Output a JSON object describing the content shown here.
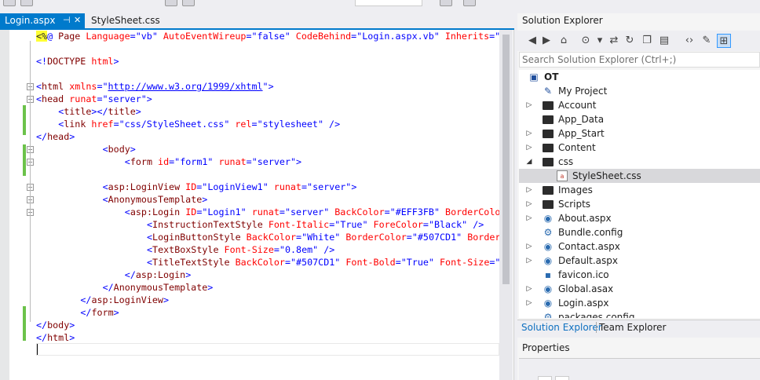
{
  "document_tabs": [
    {
      "label": "Login.aspx",
      "pin": "⊣",
      "close": "✕"
    },
    {
      "label": "StyleSheet.css"
    }
  ],
  "editor": {
    "lines": [
      {
        "indent": 0,
        "tokens": [
          {
            "t": "<%",
            "c": "c-asp"
          },
          {
            "t": "@",
            "c": "c-delim"
          },
          {
            "t": " Page ",
            "c": "c-tag"
          },
          {
            "t": "Language",
            "c": "c-attr"
          },
          {
            "t": "=",
            "c": "c-delim"
          },
          {
            "t": "\"vb\"",
            "c": "c-str"
          },
          {
            "t": " AutoEventWireup",
            "c": "c-attr"
          },
          {
            "t": "=",
            "c": "c-delim"
          },
          {
            "t": "\"false\"",
            "c": "c-str"
          },
          {
            "t": " CodeBehind",
            "c": "c-attr"
          },
          {
            "t": "=",
            "c": "c-delim"
          },
          {
            "t": "\"Login.aspx.vb\"",
            "c": "c-str"
          },
          {
            "t": " Inherits",
            "c": "c-attr"
          },
          {
            "t": "=",
            "c": "c-delim"
          },
          {
            "t": "\"O",
            "c": "c-str"
          }
        ]
      },
      {
        "indent": 0,
        "tokens": []
      },
      {
        "indent": 0,
        "tokens": [
          {
            "t": "<!",
            "c": "c-delim"
          },
          {
            "t": "DOCTYPE",
            "c": "c-tag"
          },
          {
            "t": " html",
            "c": "c-attr"
          },
          {
            "t": ">",
            "c": "c-delim"
          }
        ]
      },
      {
        "indent": 0,
        "tokens": []
      },
      {
        "indent": 0,
        "tokens": [
          {
            "t": "<",
            "c": "c-delim"
          },
          {
            "t": "html",
            "c": "c-tag"
          },
          {
            "t": " xmlns",
            "c": "c-attr"
          },
          {
            "t": "=\"",
            "c": "c-delim"
          },
          {
            "t": "http://www.w3.org/1999/xhtml",
            "c": "c-link"
          },
          {
            "t": "\">",
            "c": "c-delim"
          }
        ]
      },
      {
        "indent": 0,
        "tokens": [
          {
            "t": "<",
            "c": "c-delim"
          },
          {
            "t": "head",
            "c": "c-tag"
          },
          {
            "t": " runat",
            "c": "c-attr"
          },
          {
            "t": "=",
            "c": "c-delim"
          },
          {
            "t": "\"server\"",
            "c": "c-str"
          },
          {
            "t": ">",
            "c": "c-delim"
          }
        ]
      },
      {
        "indent": 4,
        "tokens": [
          {
            "t": "<",
            "c": "c-delim"
          },
          {
            "t": "title",
            "c": "c-tag"
          },
          {
            "t": "></",
            "c": "c-delim"
          },
          {
            "t": "title",
            "c": "c-tag"
          },
          {
            "t": ">",
            "c": "c-delim"
          }
        ]
      },
      {
        "indent": 4,
        "tokens": [
          {
            "t": "<",
            "c": "c-delim"
          },
          {
            "t": "link",
            "c": "c-tag"
          },
          {
            "t": " href",
            "c": "c-attr"
          },
          {
            "t": "=",
            "c": "c-delim"
          },
          {
            "t": "\"css/StyleSheet.css\"",
            "c": "c-str"
          },
          {
            "t": " rel",
            "c": "c-attr"
          },
          {
            "t": "=",
            "c": "c-delim"
          },
          {
            "t": "\"stylesheet\"",
            "c": "c-str"
          },
          {
            "t": " />",
            "c": "c-delim"
          }
        ]
      },
      {
        "indent": 0,
        "tokens": [
          {
            "t": "</",
            "c": "c-delim"
          },
          {
            "t": "head",
            "c": "c-tag"
          },
          {
            "t": ">",
            "c": "c-delim"
          }
        ]
      },
      {
        "indent": 12,
        "tokens": [
          {
            "t": "<",
            "c": "c-delim"
          },
          {
            "t": "body",
            "c": "c-tag"
          },
          {
            "t": ">",
            "c": "c-delim"
          }
        ]
      },
      {
        "indent": 16,
        "tokens": [
          {
            "t": "<",
            "c": "c-delim"
          },
          {
            "t": "form",
            "c": "c-tag"
          },
          {
            "t": " id",
            "c": "c-attr"
          },
          {
            "t": "=",
            "c": "c-delim"
          },
          {
            "t": "\"form1\"",
            "c": "c-str"
          },
          {
            "t": " runat",
            "c": "c-attr"
          },
          {
            "t": "=",
            "c": "c-delim"
          },
          {
            "t": "\"server\"",
            "c": "c-str"
          },
          {
            "t": ">",
            "c": "c-delim"
          }
        ]
      },
      {
        "indent": 0,
        "tokens": []
      },
      {
        "indent": 12,
        "tokens": [
          {
            "t": "<",
            "c": "c-delim"
          },
          {
            "t": "asp:LoginView",
            "c": "c-tag"
          },
          {
            "t": " ID",
            "c": "c-attr"
          },
          {
            "t": "=",
            "c": "c-delim"
          },
          {
            "t": "\"LoginView1\"",
            "c": "c-str"
          },
          {
            "t": " runat",
            "c": "c-attr"
          },
          {
            "t": "=",
            "c": "c-delim"
          },
          {
            "t": "\"server\"",
            "c": "c-str"
          },
          {
            "t": ">",
            "c": "c-delim"
          }
        ]
      },
      {
        "indent": 12,
        "tokens": [
          {
            "t": "<",
            "c": "c-delim"
          },
          {
            "t": "AnonymousTemplate",
            "c": "c-tag"
          },
          {
            "t": ">",
            "c": "c-delim"
          }
        ]
      },
      {
        "indent": 16,
        "tokens": [
          {
            "t": "<",
            "c": "c-delim"
          },
          {
            "t": "asp:Login",
            "c": "c-tag"
          },
          {
            "t": " ID",
            "c": "c-attr"
          },
          {
            "t": "=",
            "c": "c-delim"
          },
          {
            "t": "\"Login1\"",
            "c": "c-str"
          },
          {
            "t": " runat",
            "c": "c-attr"
          },
          {
            "t": "=",
            "c": "c-delim"
          },
          {
            "t": "\"server\"",
            "c": "c-str"
          },
          {
            "t": " BackColor",
            "c": "c-attr"
          },
          {
            "t": "=",
            "c": "c-delim"
          },
          {
            "t": "\"#EFF3FB\"",
            "c": "c-str"
          },
          {
            "t": " BorderColo",
            "c": "c-attr"
          }
        ]
      },
      {
        "indent": 20,
        "tokens": [
          {
            "t": "<",
            "c": "c-delim"
          },
          {
            "t": "InstructionTextStyle",
            "c": "c-tag"
          },
          {
            "t": " Font-Italic",
            "c": "c-attr"
          },
          {
            "t": "=",
            "c": "c-delim"
          },
          {
            "t": "\"True\"",
            "c": "c-str"
          },
          {
            "t": " ForeColor",
            "c": "c-attr"
          },
          {
            "t": "=",
            "c": "c-delim"
          },
          {
            "t": "\"Black\"",
            "c": "c-str"
          },
          {
            "t": " />",
            "c": "c-delim"
          }
        ]
      },
      {
        "indent": 20,
        "tokens": [
          {
            "t": "<",
            "c": "c-delim"
          },
          {
            "t": "LoginButtonStyle",
            "c": "c-tag"
          },
          {
            "t": " BackColor",
            "c": "c-attr"
          },
          {
            "t": "=",
            "c": "c-delim"
          },
          {
            "t": "\"White\"",
            "c": "c-str"
          },
          {
            "t": " BorderColor",
            "c": "c-attr"
          },
          {
            "t": "=",
            "c": "c-delim"
          },
          {
            "t": "\"#507CD1\"",
            "c": "c-str"
          },
          {
            "t": " BorderS",
            "c": "c-attr"
          }
        ]
      },
      {
        "indent": 20,
        "tokens": [
          {
            "t": "<",
            "c": "c-delim"
          },
          {
            "t": "TextBoxStyle",
            "c": "c-tag"
          },
          {
            "t": " Font-Size",
            "c": "c-attr"
          },
          {
            "t": "=",
            "c": "c-delim"
          },
          {
            "t": "\"0.8em\"",
            "c": "c-str"
          },
          {
            "t": " />",
            "c": "c-delim"
          }
        ]
      },
      {
        "indent": 20,
        "tokens": [
          {
            "t": "<",
            "c": "c-delim"
          },
          {
            "t": "TitleTextStyle",
            "c": "c-tag"
          },
          {
            "t": " BackColor",
            "c": "c-attr"
          },
          {
            "t": "=",
            "c": "c-delim"
          },
          {
            "t": "\"#507CD1\"",
            "c": "c-str"
          },
          {
            "t": " Font-Bold",
            "c": "c-attr"
          },
          {
            "t": "=",
            "c": "c-delim"
          },
          {
            "t": "\"True\"",
            "c": "c-str"
          },
          {
            "t": " Font-Size",
            "c": "c-attr"
          },
          {
            "t": "=\"",
            "c": "c-delim"
          }
        ]
      },
      {
        "indent": 16,
        "tokens": [
          {
            "t": "</",
            "c": "c-delim"
          },
          {
            "t": "asp:Login",
            "c": "c-tag"
          },
          {
            "t": ">",
            "c": "c-delim"
          }
        ]
      },
      {
        "indent": 12,
        "tokens": [
          {
            "t": "</",
            "c": "c-delim"
          },
          {
            "t": "AnonymousTemplate",
            "c": "c-tag"
          },
          {
            "t": ">",
            "c": "c-delim"
          }
        ]
      },
      {
        "indent": 8,
        "tokens": [
          {
            "t": "</",
            "c": "c-delim"
          },
          {
            "t": "asp:LoginView",
            "c": "c-tag"
          },
          {
            "t": ">",
            "c": "c-delim"
          }
        ]
      },
      {
        "indent": 8,
        "tokens": [
          {
            "t": "</",
            "c": "c-delim"
          },
          {
            "t": "form",
            "c": "c-tag"
          },
          {
            "t": ">",
            "c": "c-delim"
          }
        ]
      },
      {
        "indent": 0,
        "tokens": [
          {
            "t": "</",
            "c": "c-delim"
          },
          {
            "t": "body",
            "c": "c-tag"
          },
          {
            "t": ">",
            "c": "c-delim"
          }
        ]
      },
      {
        "indent": 0,
        "tokens": [
          {
            "t": "</",
            "c": "c-delim"
          },
          {
            "t": "html",
            "c": "c-tag"
          },
          {
            "t": ">",
            "c": "c-delim"
          }
        ]
      }
    ]
  },
  "solution_explorer": {
    "title": "Solution Explorer",
    "search_placeholder": "Search Solution Explorer (Ctrl+;)",
    "search_icon": "⌕",
    "toolbar_icons": [
      {
        "name": "back-icon",
        "glyph": "◀"
      },
      {
        "name": "forward-icon",
        "glyph": "▶"
      },
      {
        "name": "home-icon",
        "glyph": "⌂"
      },
      {
        "name": "history-icon",
        "glyph": "⊙"
      },
      {
        "name": "dropdown-arrow-icon",
        "glyph": "▾"
      },
      {
        "name": "sync-icon",
        "glyph": "⇄"
      },
      {
        "name": "refresh-icon",
        "glyph": "↻"
      },
      {
        "name": "collapse-all-icon",
        "glyph": "❐"
      },
      {
        "name": "show-all-files-icon",
        "glyph": "▤"
      },
      {
        "name": "view-code-icon",
        "glyph": "‹›"
      },
      {
        "name": "properties-icon",
        "glyph": "✎"
      },
      {
        "name": "preview-icon",
        "glyph": "⊞"
      }
    ],
    "tree": [
      {
        "label": "OT",
        "icon": "proj",
        "glyph": "▣",
        "level": 0,
        "expander": "",
        "bold": true
      },
      {
        "label": "My Project",
        "icon": "proj",
        "glyph": "✎",
        "level": 1,
        "expander": ""
      },
      {
        "label": "Account",
        "icon": "folder",
        "level": 1,
        "expander": "▷"
      },
      {
        "label": "App_Data",
        "icon": "folder",
        "level": 1,
        "expander": ""
      },
      {
        "label": "App_Start",
        "icon": "folder",
        "level": 1,
        "expander": "▷"
      },
      {
        "label": "Content",
        "icon": "folder",
        "level": 1,
        "expander": "▷"
      },
      {
        "label": "css",
        "icon": "folder",
        "level": 1,
        "expander": "◢"
      },
      {
        "label": "StyleSheet.css",
        "icon": "file-css",
        "glyph": "a",
        "level": 2,
        "expander": "",
        "selected": true
      },
      {
        "label": "Images",
        "icon": "folder",
        "level": 1,
        "expander": "▷"
      },
      {
        "label": "Scripts",
        "icon": "folder",
        "level": 1,
        "expander": "▷"
      },
      {
        "label": "About.aspx",
        "icon": "file-web",
        "glyph": "◉",
        "level": 1,
        "expander": "▷"
      },
      {
        "label": "Bundle.config",
        "icon": "file-cfg",
        "glyph": "⚙",
        "level": 1,
        "expander": ""
      },
      {
        "label": "Contact.aspx",
        "icon": "file-web",
        "glyph": "◉",
        "level": 1,
        "expander": "▷"
      },
      {
        "label": "Default.aspx",
        "icon": "file-web",
        "glyph": "◉",
        "level": 1,
        "expander": "▷"
      },
      {
        "label": "favicon.ico",
        "icon": "file-cfg",
        "glyph": "▪",
        "level": 1,
        "expander": ""
      },
      {
        "label": "Global.asax",
        "icon": "file-web",
        "glyph": "◉",
        "level": 1,
        "expander": "▷"
      },
      {
        "label": "Login.aspx",
        "icon": "file-web",
        "glyph": "◉",
        "level": 1,
        "expander": "▷"
      },
      {
        "label": "packages.config",
        "icon": "file-cfg",
        "glyph": "⚙",
        "level": 1,
        "expander": ""
      }
    ],
    "bottom_tabs": [
      "Solution Explorer",
      "Team Explorer"
    ]
  },
  "properties": {
    "title": "Properties"
  },
  "colors": {
    "accent": "#007acc",
    "change_bar": "#6cc24a",
    "selection": "#d8d8db"
  }
}
